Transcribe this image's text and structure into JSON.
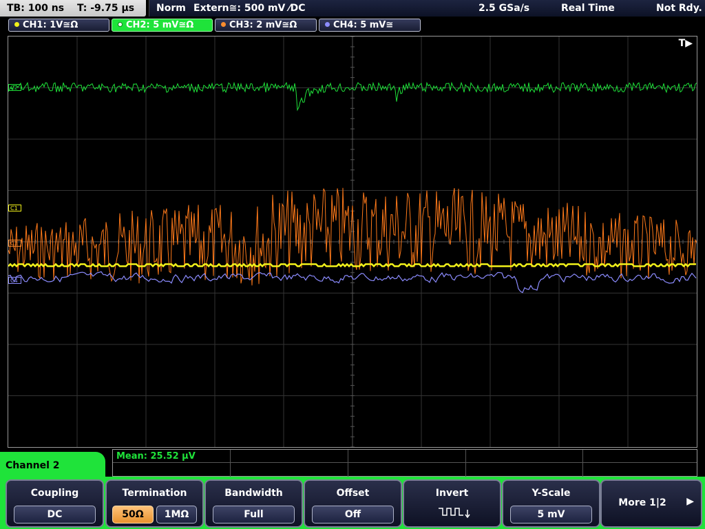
{
  "top": {
    "timebase": "TB: 100 ns",
    "trigger_pos": "T: -9.75 µs",
    "mode": "Norm",
    "trigger_src": "Extern≅: 500 mV ⁄DC",
    "sample_rate": "2.5 GSa/s",
    "acq_mode": "Real Time",
    "status": "Not Rdy."
  },
  "channels": [
    {
      "label": "CH1: 1V≅Ω",
      "color": "#f2f21a"
    },
    {
      "label": "CH2: 5 mV≅Ω",
      "color": "#1fe33a"
    },
    {
      "label": "CH3: 2 mV≅Ω",
      "color": "#ff8c2e"
    },
    {
      "label": "CH4: 5 mV≅",
      "color": "#8c8cff"
    }
  ],
  "trace_labels": {
    "c2": "C2",
    "c1": "C1",
    "c3": "C3",
    "c4": "C4"
  },
  "trigger_marker": "T▶",
  "measurement": {
    "mean": "Mean: 25.52 µV"
  },
  "menu": {
    "title": "Channel 2",
    "softkeys": [
      {
        "label": "Coupling",
        "value": "DC"
      },
      {
        "label": "Termination",
        "values": [
          "50Ω",
          "1MΩ"
        ],
        "selected": 0
      },
      {
        "label": "Bandwidth",
        "value": "Full"
      },
      {
        "label": "Offset",
        "value": "Off"
      },
      {
        "label": "Invert",
        "icon": "inverted-square-wave-icon"
      },
      {
        "label": "Y-Scale",
        "value": "5 mV"
      }
    ],
    "more": "More 1|2"
  }
}
